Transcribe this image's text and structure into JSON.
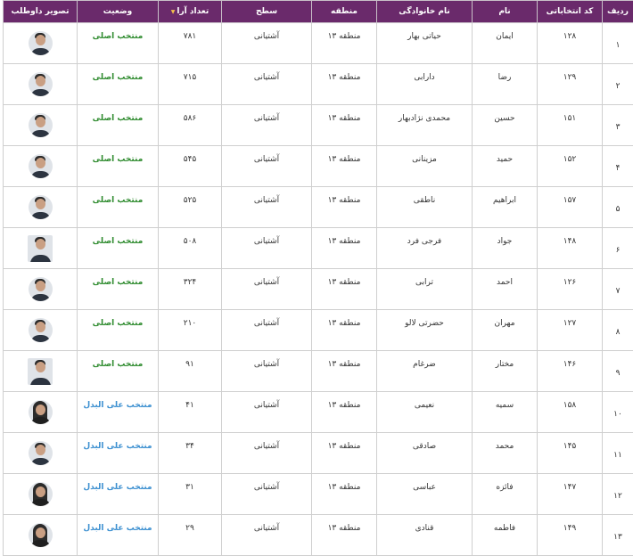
{
  "columns": {
    "index": "ردیف",
    "code": "کد انتخاباتی",
    "first_name": "نام",
    "last_name": "نام خانوادگی",
    "region": "منطقه",
    "level": "سطح",
    "votes": "تعداد آرا",
    "status": "وضعیت",
    "photo": "تصویر داوطلب"
  },
  "colors": {
    "header_bg": "#6a2a6b",
    "status_main": "#2e8b2e",
    "status_alt": "#3b8fd0"
  },
  "rows": [
    {
      "index": "۱",
      "code": "۱۲۸",
      "first_name": "ایمان",
      "last_name": "حیاتی بهار",
      "region": "منطقه ۱۳",
      "level": "آشتیانی",
      "votes": "۷۸۱",
      "status": "منتخب اصلی",
      "status_type": "main",
      "photo_icon": "male-avatar-icon"
    },
    {
      "index": "۲",
      "code": "۱۲۹",
      "first_name": "رضا",
      "last_name": "دارابی",
      "region": "منطقه ۱۳",
      "level": "آشتیانی",
      "votes": "۷۱۵",
      "status": "منتخب اصلی",
      "status_type": "main",
      "photo_icon": "male-avatar-icon"
    },
    {
      "index": "۳",
      "code": "۱۵۱",
      "first_name": "حسین",
      "last_name": "محمدی نژادبهار",
      "region": "منطقه ۱۳",
      "level": "آشتیانی",
      "votes": "۵۸۶",
      "status": "منتخب اصلی",
      "status_type": "main",
      "photo_icon": "male-avatar-icon"
    },
    {
      "index": "۴",
      "code": "۱۵۲",
      "first_name": "حمید",
      "last_name": "مزینانی",
      "region": "منطقه ۱۳",
      "level": "آشتیانی",
      "votes": "۵۴۵",
      "status": "منتخب اصلی",
      "status_type": "main",
      "photo_icon": "male-avatar-icon"
    },
    {
      "index": "۵",
      "code": "۱۵۷",
      "first_name": "ابراهیم",
      "last_name": "ناطقی",
      "region": "منطقه ۱۳",
      "level": "آشتیانی",
      "votes": "۵۲۵",
      "status": "منتخب اصلی",
      "status_type": "main",
      "photo_icon": "male-avatar-icon"
    },
    {
      "index": "۶",
      "code": "۱۴۸",
      "first_name": "جواد",
      "last_name": "فرجی فرد",
      "region": "منطقه ۱۳",
      "level": "آشتیانی",
      "votes": "۵۰۸",
      "status": "منتخب اصلی",
      "status_type": "main",
      "photo_icon": "male-avatar-icon"
    },
    {
      "index": "۷",
      "code": "۱۲۶",
      "first_name": "احمد",
      "last_name": "ترابی",
      "region": "منطقه ۱۳",
      "level": "آشتیانی",
      "votes": "۳۲۴",
      "status": "منتخب اصلی",
      "status_type": "main",
      "photo_icon": "male-avatar-icon"
    },
    {
      "index": "۸",
      "code": "۱۲۷",
      "first_name": "مهران",
      "last_name": "حضرتی لالو",
      "region": "منطقه ۱۳",
      "level": "آشتیانی",
      "votes": "۲۱۰",
      "status": "منتخب اصلی",
      "status_type": "main",
      "photo_icon": "male-avatar-icon"
    },
    {
      "index": "۹",
      "code": "۱۴۶",
      "first_name": "مختار",
      "last_name": "ضرغام",
      "region": "منطقه ۱۳",
      "level": "آشتیانی",
      "votes": "۹۱",
      "status": "منتخب اصلی",
      "status_type": "main",
      "photo_icon": "male-avatar-icon"
    },
    {
      "index": "۱۰",
      "code": "۱۵۸",
      "first_name": "سمیه",
      "last_name": "نعیمی",
      "region": "منطقه ۱۳",
      "level": "آشتیانی",
      "votes": "۴۱",
      "status": "منتخب علی البدل",
      "status_type": "alt",
      "photo_icon": "female-avatar-icon"
    },
    {
      "index": "۱۱",
      "code": "۱۴۵",
      "first_name": "محمد",
      "last_name": "صادقی",
      "region": "منطقه ۱۳",
      "level": "آشتیانی",
      "votes": "۳۴",
      "status": "منتخب علی البدل",
      "status_type": "alt",
      "photo_icon": "male-avatar-icon"
    },
    {
      "index": "۱۲",
      "code": "۱۴۷",
      "first_name": "فائزه",
      "last_name": "عباسی",
      "region": "منطقه ۱۳",
      "level": "آشتیانی",
      "votes": "۳۱",
      "status": "منتخب علی البدل",
      "status_type": "alt",
      "photo_icon": "female-avatar-icon"
    },
    {
      "index": "۱۳",
      "code": "۱۴۹",
      "first_name": "فاطمه",
      "last_name": "قنادی",
      "region": "منطقه ۱۳",
      "level": "آشتیانی",
      "votes": "۲۹",
      "status": "منتخب علی البدل",
      "status_type": "alt",
      "photo_icon": "female-avatar-icon"
    }
  ]
}
